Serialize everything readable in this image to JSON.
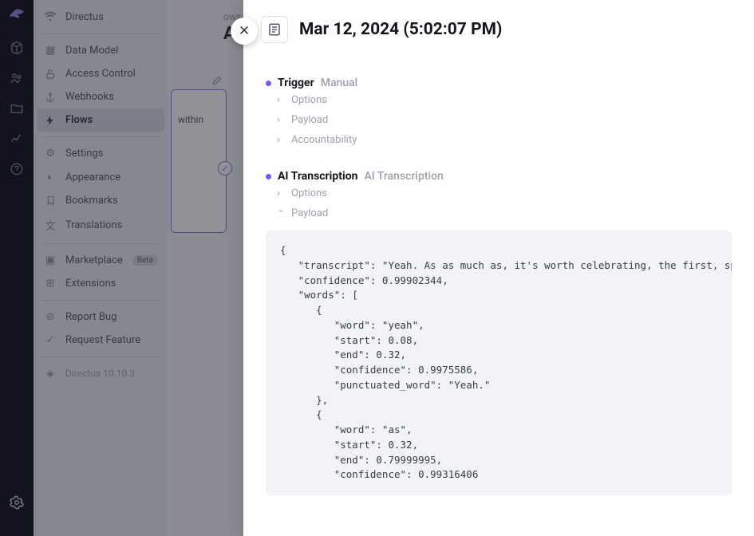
{
  "productName": "Directus",
  "version": "Directus 10.10.3",
  "railIcons": [
    "logo",
    "cube",
    "users",
    "folder",
    "chart",
    "help",
    "gear"
  ],
  "sidebar": {
    "brand": "Directus",
    "items": [
      {
        "icon": "grid",
        "label": "Data Model"
      },
      {
        "icon": "lock",
        "label": "Access Control"
      },
      {
        "icon": "anchor",
        "label": "Webhooks"
      },
      {
        "icon": "bolt",
        "label": "Flows",
        "active": true
      }
    ],
    "items2": [
      {
        "icon": "sliders",
        "label": "Settings"
      },
      {
        "icon": "palette",
        "label": "Appearance"
      },
      {
        "icon": "bookmark",
        "label": "Bookmarks"
      },
      {
        "icon": "translate",
        "label": "Translations"
      }
    ],
    "items3": [
      {
        "icon": "store",
        "label": "Marketplace",
        "badge": "Beta"
      },
      {
        "icon": "puzzle",
        "label": "Extensions"
      }
    ],
    "items4": [
      {
        "icon": "bug",
        "label": "Report Bug"
      },
      {
        "icon": "check",
        "label": "Request Feature"
      }
    ]
  },
  "canvas": {
    "crumb": "ows",
    "titlePartial": "Aut",
    "nodeText": "within"
  },
  "drawer": {
    "title": "Mar 12, 2024 (5:02:07 PM)",
    "sections": [
      {
        "name": "Trigger",
        "sub": "Manual",
        "rows": [
          {
            "label": "Options",
            "open": false
          },
          {
            "label": "Payload",
            "open": false
          },
          {
            "label": "Accountability",
            "open": false
          }
        ]
      },
      {
        "name": "AI Transcription",
        "sub": "AI Transcription",
        "rows": [
          {
            "label": "Options",
            "open": false
          },
          {
            "label": "Payload",
            "open": true
          }
        ]
      }
    ],
    "payloadCode": "{\n   \"transcript\": \"Yeah. As as much as, it's worth celebrating, the first, spacewalk, with an all female team, I think many of us are looking forward to it just being normal. And, I think if it signifies anything, it is, to honor the the women who came before us who, were skilled and qualified, and didn't get the the same opportunities that we have today.\",\n   \"confidence\": 0.99902344,\n   \"words\": [\n      {\n         \"word\": \"yeah\",\n         \"start\": 0.08,\n         \"end\": 0.32,\n         \"confidence\": 0.9975586,\n         \"punctuated_word\": \"Yeah.\"\n      },\n      {\n         \"word\": \"as\",\n         \"start\": 0.32,\n         \"end\": 0.79999995,\n         \"confidence\": 0.99316406"
  }
}
